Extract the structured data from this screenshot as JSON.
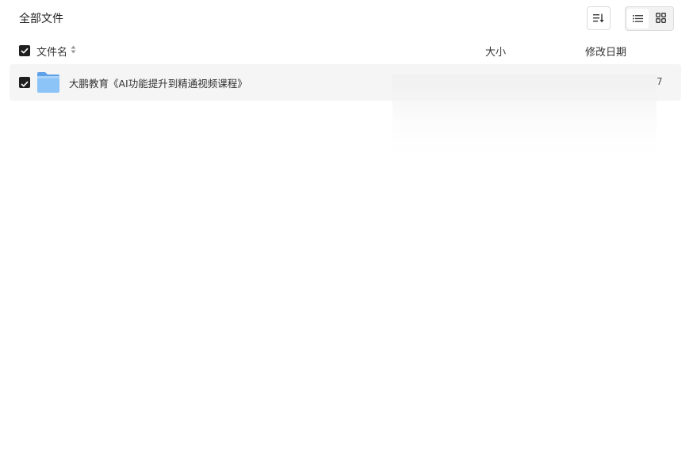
{
  "header": {
    "title": "全部文件",
    "sort_icon": "sort-icon",
    "view_modes": [
      {
        "icon": "list-view-icon",
        "active": true
      },
      {
        "icon": "grid-view-icon",
        "active": false
      }
    ]
  },
  "columns": {
    "name": "文件名",
    "size": "大小",
    "modified": "修改日期"
  },
  "files": [
    {
      "icon": "folder-icon",
      "name": "大鹏教育《AI功能提升到精通视频课程》",
      "size": "",
      "modified": "7",
      "checked": true
    }
  ],
  "colors": {
    "checkbox": "#1f1f1f",
    "folder": "#7fb9f1",
    "row_bg": "#f5f5f5"
  }
}
